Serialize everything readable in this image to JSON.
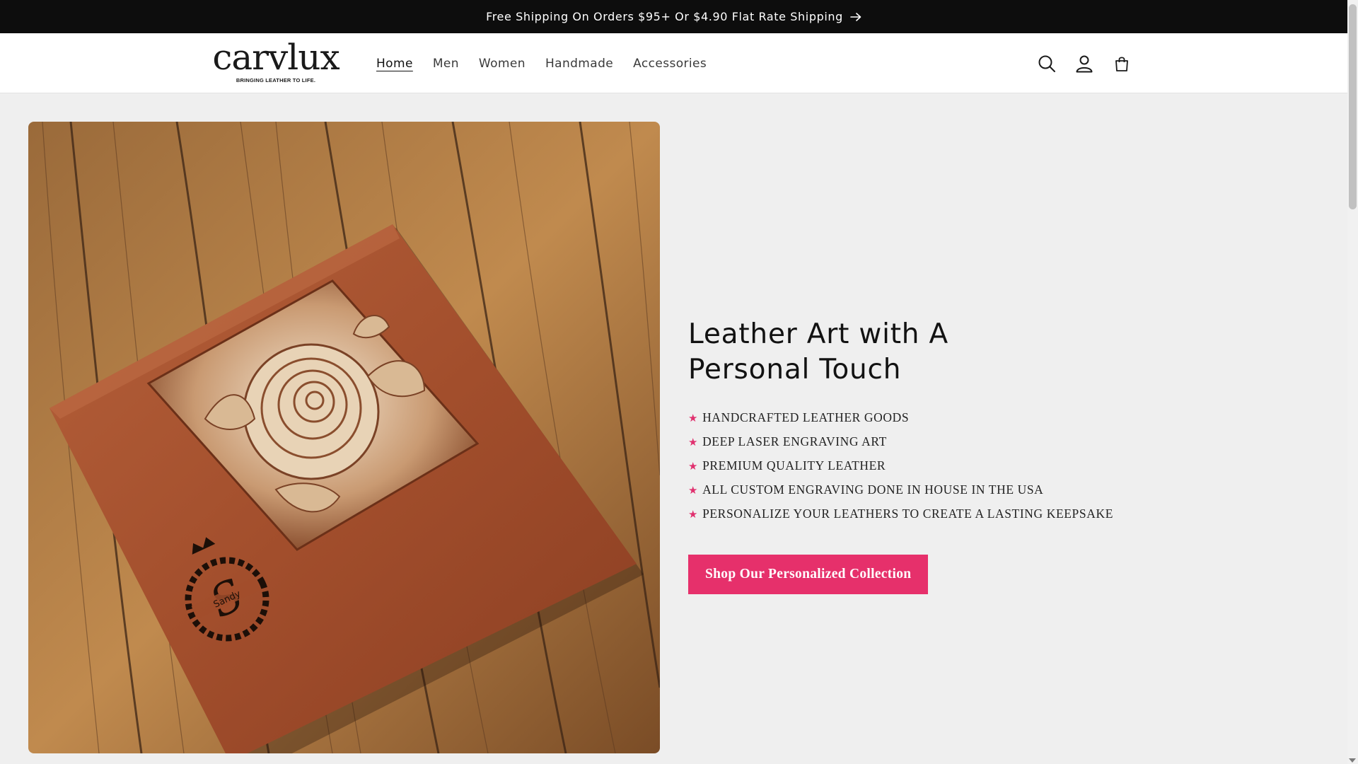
{
  "announcement": {
    "text": "Free Shipping On Orders $95+ Or $4.90 Flat Rate Shipping",
    "icon": "arrow-right-icon"
  },
  "header": {
    "logo": {
      "word": "carvlux",
      "tagline": "BRINGING LEATHER TO LIFE."
    },
    "nav": [
      {
        "label": "Home",
        "active": true
      },
      {
        "label": "Men"
      },
      {
        "label": "Women"
      },
      {
        "label": "Handmade"
      },
      {
        "label": "Accessories"
      }
    ],
    "icons": [
      "search-icon",
      "account-icon",
      "cart-icon"
    ]
  },
  "hero": {
    "image": {
      "monogram_letter": "S",
      "monogram_name": "Sandy"
    },
    "title_line1": "Leather Art with A",
    "title_line2": "Personal Touch",
    "features": [
      "HANDCRAFTED LEATHER GOODS",
      "DEEP LASER ENGRAVING ART",
      "PREMIUM QUALITY LEATHER",
      "ALL CUSTOM ENGRAVING DONE IN HOUSE IN THE USA",
      "PERSONALIZE YOUR LEATHERS TO CREATE A LASTING KEEPSAKE"
    ],
    "feature_bullet": "★",
    "cta_label": "Shop Our Personalized Collection"
  },
  "colors": {
    "announcement_bg": "#0d0d0d",
    "page_bg": "#efefef",
    "accent": "#e6306b"
  }
}
